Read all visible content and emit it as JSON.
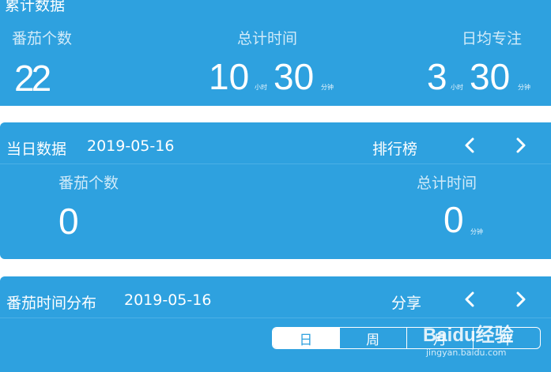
{
  "cumulative": {
    "title": "累计数据",
    "tomato_count_label": "番茄个数",
    "tomato_count_value": "22",
    "total_time_label": "总计时间",
    "total_hours": "10",
    "hour_unit": "小时",
    "total_minutes": "30",
    "minute_unit": "分钟",
    "daily_avg_label": "日均专注",
    "avg_hours": "3",
    "avg_minutes": "30"
  },
  "daily": {
    "title": "当日数据",
    "date": "2019-05-16",
    "ranking_label": "排行榜",
    "tomato_count_label": "番茄个数",
    "tomato_count_value": "0",
    "total_time_label": "总计时间",
    "total_minutes": "0",
    "minute_unit": "分钟"
  },
  "distribution": {
    "title": "番茄时间分布",
    "date": "2019-05-16",
    "share_label": "分享",
    "tabs": [
      {
        "label": "日",
        "active": true
      },
      {
        "label": "周",
        "active": false
      },
      {
        "label": "月",
        "active": false
      },
      {
        "label": "年",
        "active": false
      }
    ]
  },
  "watermark": {
    "brand": "Baidu经验",
    "url": "jingyan.baidu.com"
  },
  "colors": {
    "card_bg": "#2ea1df",
    "page_bg": "#ffffff",
    "label_text": "#d2ebf9"
  }
}
